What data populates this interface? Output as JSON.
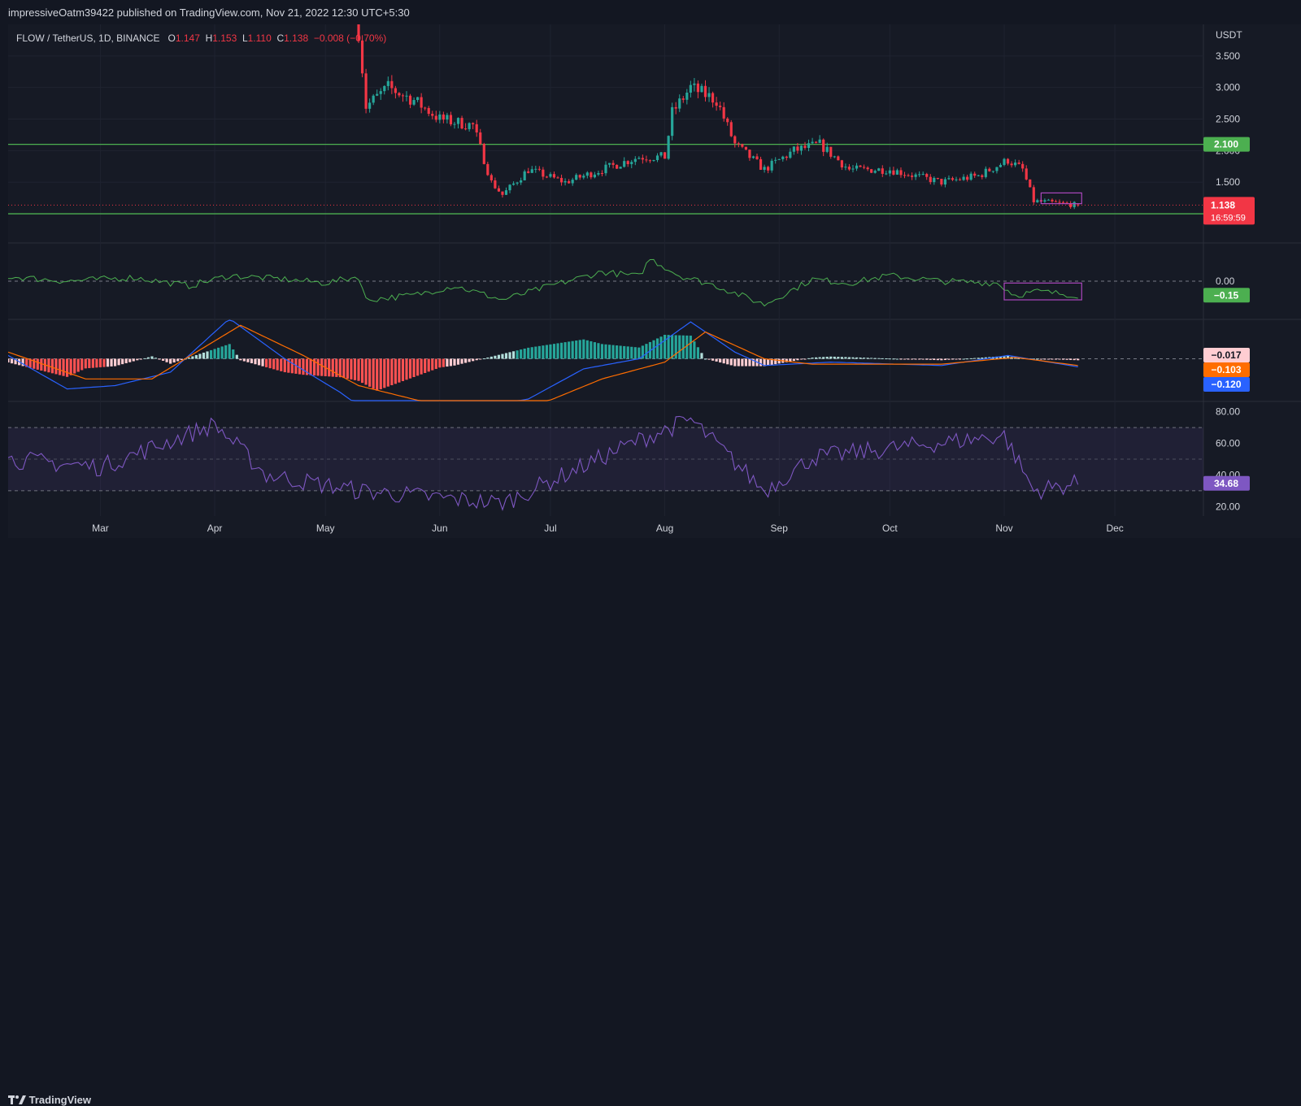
{
  "header": {
    "published_text": "impressiveOatm39422 published on TradingView.com, Nov 21, 2022 12:30 UTC+5:30"
  },
  "legend": {
    "symbol": "FLOW / TetherUS, 1D, BINANCE",
    "o_label": "O",
    "o_value": "1.147",
    "h_label": "H",
    "h_value": "1.153",
    "l_label": "L",
    "l_value": "1.110",
    "c_label": "C",
    "c_value": "1.138",
    "change": "−0.008 (−0.70%)"
  },
  "footer": {
    "brand": "TradingView"
  },
  "colors": {
    "up": "#26a69a",
    "down": "#f23645",
    "level_line": "#4caf50",
    "osc_line": "#4caf50",
    "macd_line": "#2962ff",
    "signal_line": "#ff6d00",
    "rsi_line": "#7e57c2",
    "highlight_box": "#ab47bc"
  },
  "chart_data": [
    {
      "type": "candlestick",
      "pane": "price",
      "y_unit": "USDT",
      "y_ticks": [
        "3.500",
        "3.000",
        "2.500",
        "2.000",
        "1.500"
      ],
      "ylim": [
        0.55,
        4.0
      ],
      "x_months": [
        "Mar",
        "Apr",
        "May",
        "Jun",
        "Jul",
        "Aug",
        "Sep",
        "Oct",
        "Nov",
        "Dec"
      ],
      "horizontal_levels": [
        {
          "value": 2.1,
          "label": "2.100"
        },
        {
          "value": 1.0,
          "label": "1.000"
        }
      ],
      "last_price": {
        "value": 1.138,
        "label": "1.138",
        "countdown": "16:59:59"
      },
      "approx_close_path": [
        {
          "date": "2022-05-10",
          "close": 3.9
        },
        {
          "date": "2022-05-12",
          "close": 2.7
        },
        {
          "date": "2022-05-18",
          "close": 3.0
        },
        {
          "date": "2022-05-25",
          "close": 2.8
        },
        {
          "date": "2022-06-01",
          "close": 2.5
        },
        {
          "date": "2022-06-10",
          "close": 2.4
        },
        {
          "date": "2022-06-15",
          "close": 1.5
        },
        {
          "date": "2022-06-18",
          "close": 1.3
        },
        {
          "date": "2022-06-25",
          "close": 1.7
        },
        {
          "date": "2022-07-05",
          "close": 1.5
        },
        {
          "date": "2022-07-15",
          "close": 1.7
        },
        {
          "date": "2022-07-25",
          "close": 1.9
        },
        {
          "date": "2022-08-01",
          "close": 1.9
        },
        {
          "date": "2022-08-03",
          "close": 2.6
        },
        {
          "date": "2022-08-08",
          "close": 3.0
        },
        {
          "date": "2022-08-15",
          "close": 2.8
        },
        {
          "date": "2022-08-20",
          "close": 2.1
        },
        {
          "date": "2022-08-28",
          "close": 1.7
        },
        {
          "date": "2022-09-05",
          "close": 2.0
        },
        {
          "date": "2022-09-12",
          "close": 2.1
        },
        {
          "date": "2022-09-20",
          "close": 1.7
        },
        {
          "date": "2022-10-01",
          "close": 1.7
        },
        {
          "date": "2022-10-15",
          "close": 1.5
        },
        {
          "date": "2022-10-25",
          "close": 1.6
        },
        {
          "date": "2022-11-02",
          "close": 1.85
        },
        {
          "date": "2022-11-06",
          "close": 1.7
        },
        {
          "date": "2022-11-09",
          "close": 1.2
        },
        {
          "date": "2022-11-21",
          "close": 1.138
        }
      ]
    },
    {
      "type": "line",
      "pane": "oscillator",
      "y_ticks": [
        "0.00"
      ],
      "ylim": [
        -0.4,
        0.4
      ],
      "last_value": {
        "value": -0.15,
        "label": "−0.15"
      }
    },
    {
      "type": "line",
      "pane": "macd",
      "series": [
        {
          "name": "",
          "last_value": "−0.017"
        },
        {
          "name": "",
          "last_value": "−0.103"
        },
        {
          "name": "",
          "last_value": "−0.120"
        }
      ],
      "ylim": [
        -0.6,
        0.6
      ]
    },
    {
      "type": "line",
      "pane": "rsi",
      "y_ticks": [
        "80.00",
        "60.00",
        "40.00",
        "20.00"
      ],
      "ylim": [
        14,
        86
      ],
      "bands": [
        70,
        50,
        30
      ],
      "last_value": {
        "value": 34.68,
        "label": "34.68"
      },
      "key_points": [
        {
          "date": "2022-03-01",
          "value": 45
        },
        {
          "date": "2022-04-01",
          "value": 72
        },
        {
          "date": "2022-04-15",
          "value": 40
        },
        {
          "date": "2022-05-10",
          "value": 30
        },
        {
          "date": "2022-06-18",
          "value": 22
        },
        {
          "date": "2022-07-25",
          "value": 62
        },
        {
          "date": "2022-08-08",
          "value": 75
        },
        {
          "date": "2022-08-28",
          "value": 30
        },
        {
          "date": "2022-09-10",
          "value": 51
        },
        {
          "date": "2022-11-01",
          "value": 65
        },
        {
          "date": "2022-11-09",
          "value": 30
        },
        {
          "date": "2022-11-21",
          "value": 34.68
        }
      ]
    }
  ]
}
